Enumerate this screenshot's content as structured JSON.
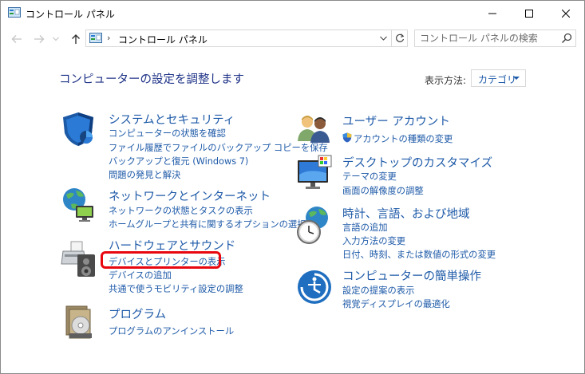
{
  "window": {
    "title": "コントロール パネル"
  },
  "navigation": {
    "breadcrumb": [
      "コントロール パネル"
    ],
    "search_placeholder": "コントロール パネルの検索"
  },
  "main": {
    "heading": "コンピューターの設定を調整します",
    "view_label": "表示方法:",
    "view_value": "カテゴリ"
  },
  "categories": [
    {
      "title": "システムとセキュリティ",
      "icon": "shield-icon",
      "links": [
        "コンピューターの状態を確認",
        "ファイル履歴でファイルのバックアップ コピーを保存",
        "バックアップと復元 (Windows 7)",
        "問題の発見と解決"
      ]
    },
    {
      "title": "ネットワークとインターネット",
      "icon": "network-globe-icon",
      "links": [
        "ネットワークの状態とタスクの表示",
        "ホームグループと共有に関するオプションの選択"
      ]
    },
    {
      "title": "ハードウェアとサウンド",
      "icon": "printer-speaker-icon",
      "links": [
        "デバイスとプリンターの表示",
        "デバイスの追加",
        "共通で使うモビリティ設定の調整"
      ]
    },
    {
      "title": "プログラム",
      "icon": "programs-disc-icon",
      "links": [
        "プログラムのアンインストール"
      ]
    },
    {
      "title": "ユーザー アカウント",
      "icon": "users-icon",
      "links": [
        "アカウントの種類の変更"
      ]
    },
    {
      "title": "デスクトップのカスタマイズ",
      "icon": "desktop-monitor-icon",
      "links": [
        "テーマの変更",
        "画面の解像度の調整"
      ]
    },
    {
      "title": "時計、言語、および地域",
      "icon": "clock-globe-icon",
      "links": [
        "言語の追加",
        "入力方法の変更",
        "日付、時刻、または数値の形式の変更"
      ]
    },
    {
      "title": "コンピューターの簡単操作",
      "icon": "ease-of-access-icon",
      "links": [
        "設定の提案の表示",
        "視覚ディスプレイの最適化"
      ]
    }
  ],
  "colors": {
    "link": "#1e5aa8",
    "heading": "#1e3287",
    "highlight": "#e8070f"
  }
}
